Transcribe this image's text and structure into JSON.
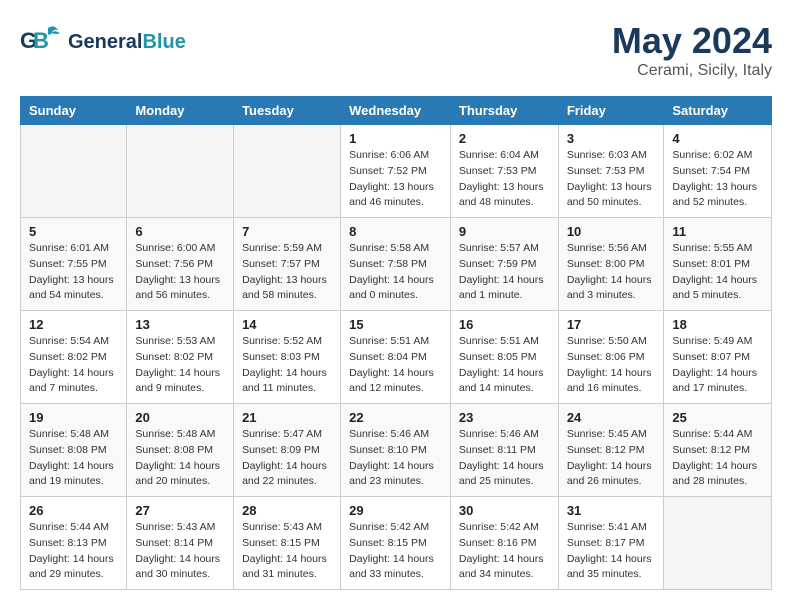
{
  "header": {
    "logo_line1": "General",
    "logo_line2": "Blue",
    "month_year": "May 2024",
    "location": "Cerami, Sicily, Italy"
  },
  "days_of_week": [
    "Sunday",
    "Monday",
    "Tuesday",
    "Wednesday",
    "Thursday",
    "Friday",
    "Saturday"
  ],
  "weeks": [
    [
      {
        "day": "",
        "empty": true
      },
      {
        "day": "",
        "empty": true
      },
      {
        "day": "",
        "empty": true
      },
      {
        "day": "1",
        "sunrise": "6:06 AM",
        "sunset": "7:52 PM",
        "daylight": "13 hours and 46 minutes."
      },
      {
        "day": "2",
        "sunrise": "6:04 AM",
        "sunset": "7:53 PM",
        "daylight": "13 hours and 48 minutes."
      },
      {
        "day": "3",
        "sunrise": "6:03 AM",
        "sunset": "7:53 PM",
        "daylight": "13 hours and 50 minutes."
      },
      {
        "day": "4",
        "sunrise": "6:02 AM",
        "sunset": "7:54 PM",
        "daylight": "13 hours and 52 minutes."
      }
    ],
    [
      {
        "day": "5",
        "sunrise": "6:01 AM",
        "sunset": "7:55 PM",
        "daylight": "13 hours and 54 minutes."
      },
      {
        "day": "6",
        "sunrise": "6:00 AM",
        "sunset": "7:56 PM",
        "daylight": "13 hours and 56 minutes."
      },
      {
        "day": "7",
        "sunrise": "5:59 AM",
        "sunset": "7:57 PM",
        "daylight": "13 hours and 58 minutes."
      },
      {
        "day": "8",
        "sunrise": "5:58 AM",
        "sunset": "7:58 PM",
        "daylight": "14 hours and 0 minutes."
      },
      {
        "day": "9",
        "sunrise": "5:57 AM",
        "sunset": "7:59 PM",
        "daylight": "14 hours and 1 minute."
      },
      {
        "day": "10",
        "sunrise": "5:56 AM",
        "sunset": "8:00 PM",
        "daylight": "14 hours and 3 minutes."
      },
      {
        "day": "11",
        "sunrise": "5:55 AM",
        "sunset": "8:01 PM",
        "daylight": "14 hours and 5 minutes."
      }
    ],
    [
      {
        "day": "12",
        "sunrise": "5:54 AM",
        "sunset": "8:02 PM",
        "daylight": "14 hours and 7 minutes."
      },
      {
        "day": "13",
        "sunrise": "5:53 AM",
        "sunset": "8:02 PM",
        "daylight": "14 hours and 9 minutes."
      },
      {
        "day": "14",
        "sunrise": "5:52 AM",
        "sunset": "8:03 PM",
        "daylight": "14 hours and 11 minutes."
      },
      {
        "day": "15",
        "sunrise": "5:51 AM",
        "sunset": "8:04 PM",
        "daylight": "14 hours and 12 minutes."
      },
      {
        "day": "16",
        "sunrise": "5:51 AM",
        "sunset": "8:05 PM",
        "daylight": "14 hours and 14 minutes."
      },
      {
        "day": "17",
        "sunrise": "5:50 AM",
        "sunset": "8:06 PM",
        "daylight": "14 hours and 16 minutes."
      },
      {
        "day": "18",
        "sunrise": "5:49 AM",
        "sunset": "8:07 PM",
        "daylight": "14 hours and 17 minutes."
      }
    ],
    [
      {
        "day": "19",
        "sunrise": "5:48 AM",
        "sunset": "8:08 PM",
        "daylight": "14 hours and 19 minutes."
      },
      {
        "day": "20",
        "sunrise": "5:48 AM",
        "sunset": "8:08 PM",
        "daylight": "14 hours and 20 minutes."
      },
      {
        "day": "21",
        "sunrise": "5:47 AM",
        "sunset": "8:09 PM",
        "daylight": "14 hours and 22 minutes."
      },
      {
        "day": "22",
        "sunrise": "5:46 AM",
        "sunset": "8:10 PM",
        "daylight": "14 hours and 23 minutes."
      },
      {
        "day": "23",
        "sunrise": "5:46 AM",
        "sunset": "8:11 PM",
        "daylight": "14 hours and 25 minutes."
      },
      {
        "day": "24",
        "sunrise": "5:45 AM",
        "sunset": "8:12 PM",
        "daylight": "14 hours and 26 minutes."
      },
      {
        "day": "25",
        "sunrise": "5:44 AM",
        "sunset": "8:12 PM",
        "daylight": "14 hours and 28 minutes."
      }
    ],
    [
      {
        "day": "26",
        "sunrise": "5:44 AM",
        "sunset": "8:13 PM",
        "daylight": "14 hours and 29 minutes."
      },
      {
        "day": "27",
        "sunrise": "5:43 AM",
        "sunset": "8:14 PM",
        "daylight": "14 hours and 30 minutes."
      },
      {
        "day": "28",
        "sunrise": "5:43 AM",
        "sunset": "8:15 PM",
        "daylight": "14 hours and 31 minutes."
      },
      {
        "day": "29",
        "sunrise": "5:42 AM",
        "sunset": "8:15 PM",
        "daylight": "14 hours and 33 minutes."
      },
      {
        "day": "30",
        "sunrise": "5:42 AM",
        "sunset": "8:16 PM",
        "daylight": "14 hours and 34 minutes."
      },
      {
        "day": "31",
        "sunrise": "5:41 AM",
        "sunset": "8:17 PM",
        "daylight": "14 hours and 35 minutes."
      },
      {
        "day": "",
        "empty": true
      }
    ]
  ]
}
